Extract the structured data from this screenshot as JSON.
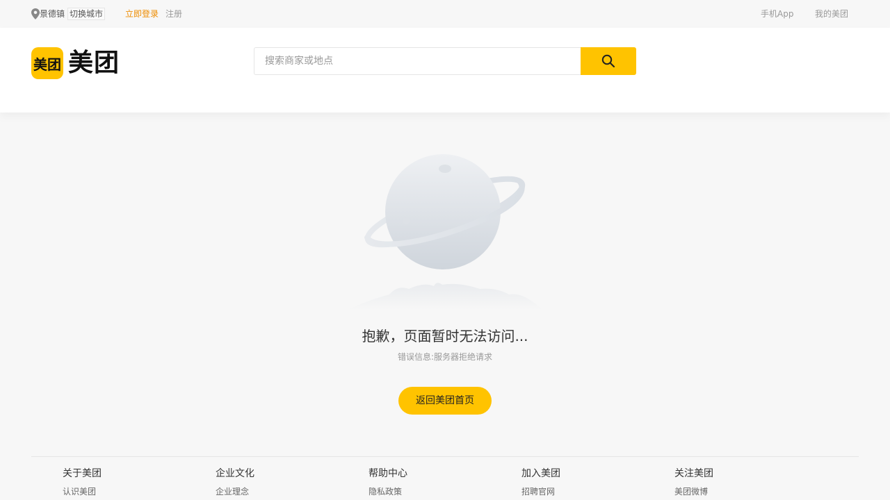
{
  "topbar": {
    "city": "景德镇",
    "switch_city": "切换城市",
    "login": "立即登录",
    "register": "注册",
    "mobile_app": "手机App",
    "my_meituan": "我的美团"
  },
  "header": {
    "logo_badge": "美团",
    "logo_text": "美团",
    "search_placeholder": "搜索商家或地点",
    "search_icon": "search-icon"
  },
  "error": {
    "title": "抱歉，页面暂时无法访问...",
    "info": "错误信息:服务器拒绝请求",
    "home_button": "返回美团首页"
  },
  "footer": {
    "columns": [
      {
        "title": "关于美团",
        "link": "认识美团"
      },
      {
        "title": "企业文化",
        "link": "企业理念"
      },
      {
        "title": "帮助中心",
        "link": "隐私政策"
      },
      {
        "title": "加入美团",
        "link": "招聘官网"
      },
      {
        "title": "关注美团",
        "link": "美团微博"
      }
    ]
  },
  "colors": {
    "brand_yellow": "#ffc300",
    "login_orange": "#ee8c00",
    "background": "#f7f7f7"
  }
}
